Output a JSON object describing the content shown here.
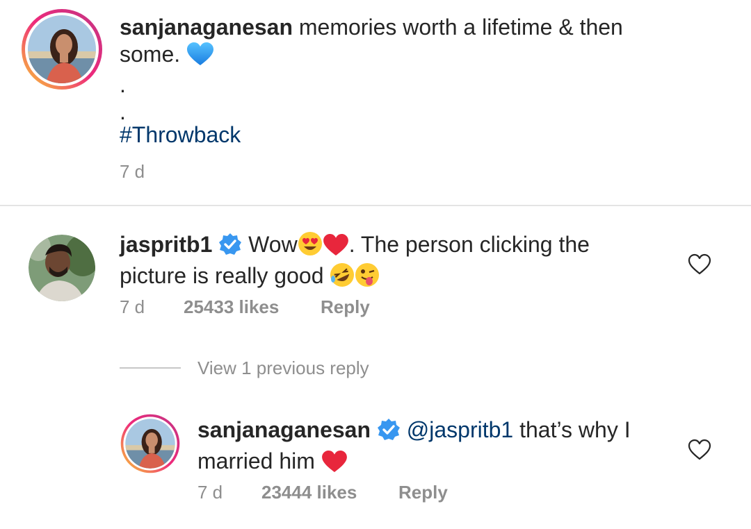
{
  "caption": {
    "username": "sanjanaganesan",
    "text": "memories worth a lifetime & then some.",
    "emoji": "blue-heart",
    "dots": [
      ".",
      "."
    ],
    "hashtag": "#Throwback",
    "time": "7 d"
  },
  "comments": [
    {
      "username": "jaspritb1",
      "verified": true,
      "text_1": "Wow",
      "text_2": ". The person clicking the",
      "text_3": "picture is really good",
      "time": "7 d",
      "likes": "25433 likes",
      "reply_label": "Reply"
    }
  ],
  "view_replies": {
    "label": "View 1 previous reply"
  },
  "replies": [
    {
      "username": "sanjanaganesan",
      "verified": true,
      "mention": "@jaspritb1",
      "text_1": "that’s why I",
      "text_2": "married him",
      "time": "7 d",
      "likes": "23444 likes",
      "reply_label": "Reply"
    }
  ],
  "colors": {
    "text": "#262626",
    "muted": "#8e8e8e",
    "link": "#00376b",
    "verified": "#3897f0",
    "story_ring": [
      "#f9ce34",
      "#ee2a7b",
      "#6228d7"
    ]
  }
}
